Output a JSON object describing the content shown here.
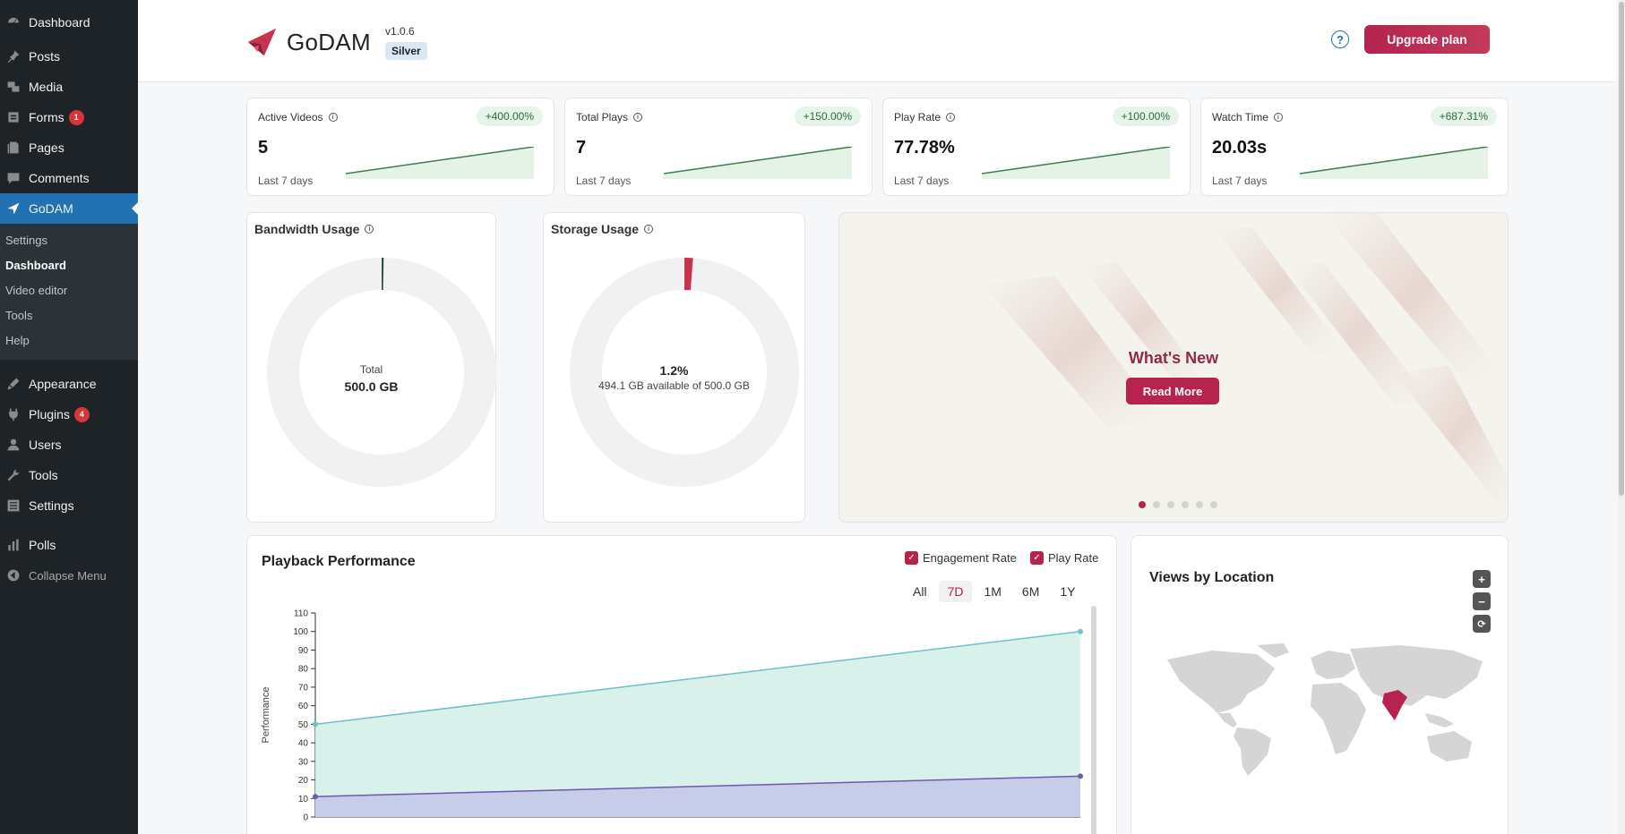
{
  "sidebar": {
    "items_top": [
      {
        "label": "Dashboard",
        "icon": "dashboard-icon"
      },
      {
        "label": "Posts",
        "icon": "pin-icon"
      },
      {
        "label": "Media",
        "icon": "media-icon"
      },
      {
        "label": "Forms",
        "icon": "forms-icon",
        "badge": "1"
      },
      {
        "label": "Pages",
        "icon": "pages-icon"
      },
      {
        "label": "Comments",
        "icon": "comment-icon"
      }
    ],
    "active": {
      "label": "GoDAM",
      "icon": "godam-icon"
    },
    "submenu": [
      "Settings",
      "Dashboard",
      "Video editor",
      "Tools",
      "Help"
    ],
    "submenu_current": "Dashboard",
    "items_bottom": [
      {
        "label": "Appearance",
        "icon": "brush-icon"
      },
      {
        "label": "Plugins",
        "icon": "plugin-icon",
        "badge": "4"
      },
      {
        "label": "Users",
        "icon": "user-icon"
      },
      {
        "label": "Tools",
        "icon": "wrench-icon"
      },
      {
        "label": "Settings",
        "icon": "settings-icon"
      }
    ],
    "polls": {
      "label": "Polls",
      "icon": "chart-icon"
    },
    "collapse": {
      "label": "Collapse Menu",
      "icon": "collapse-icon"
    }
  },
  "header": {
    "logo_text": "GoDAM",
    "version": "v1.0.6",
    "tier": "Silver",
    "help_symbol": "?",
    "upgrade_label": "Upgrade plan"
  },
  "stats": [
    {
      "title": "Active Videos",
      "value": "5",
      "change": "+400.00%",
      "period": "Last 7 days"
    },
    {
      "title": "Total Plays",
      "value": "7",
      "change": "+150.00%",
      "period": "Last 7 days"
    },
    {
      "title": "Play Rate",
      "value": "77.78%",
      "change": "+100.00%",
      "period": "Last 7 days"
    },
    {
      "title": "Watch Time",
      "value": "20.03s",
      "change": "+687.31%",
      "period": "Last 7 days"
    }
  ],
  "bandwidth": {
    "title": "Bandwidth Usage",
    "label": "Total",
    "value": "500.0 GB",
    "used_fraction": 0.002
  },
  "storage": {
    "title": "Storage Usage",
    "percent": "1.2%",
    "detail": "494.1 GB available of 500.0 GB",
    "used_fraction": 0.012
  },
  "whats_new": {
    "title": "What's New",
    "button": "Read More",
    "slides": 6,
    "active_slide": 0
  },
  "playback": {
    "title": "Playback Performance",
    "legend": [
      {
        "label": "Engagement Rate",
        "check": "✓"
      },
      {
        "label": "Play Rate",
        "check": "✓"
      }
    ],
    "ranges": [
      "All",
      "7D",
      "1M",
      "6M",
      "1Y"
    ],
    "active_range": "7D"
  },
  "map": {
    "title": "Views by Location",
    "zoom_in": "+",
    "zoom_out": "−",
    "reset": "⟳",
    "highlight": "#b5234e"
  },
  "chart_data": {
    "type": "area",
    "ylabel": "Performance",
    "ylim": [
      0,
      110
    ],
    "yticks": [
      "0",
      "10",
      "20",
      "30",
      "40",
      "50",
      "60",
      "70",
      "80",
      "90",
      "100",
      "110"
    ],
    "series": [
      {
        "name": "Engagement Rate",
        "values": [
          50,
          100
        ],
        "color": "#6fc0c8"
      },
      {
        "name": "Play Rate",
        "values": [
          11,
          22
        ],
        "color": "#6e5aa8"
      }
    ]
  }
}
